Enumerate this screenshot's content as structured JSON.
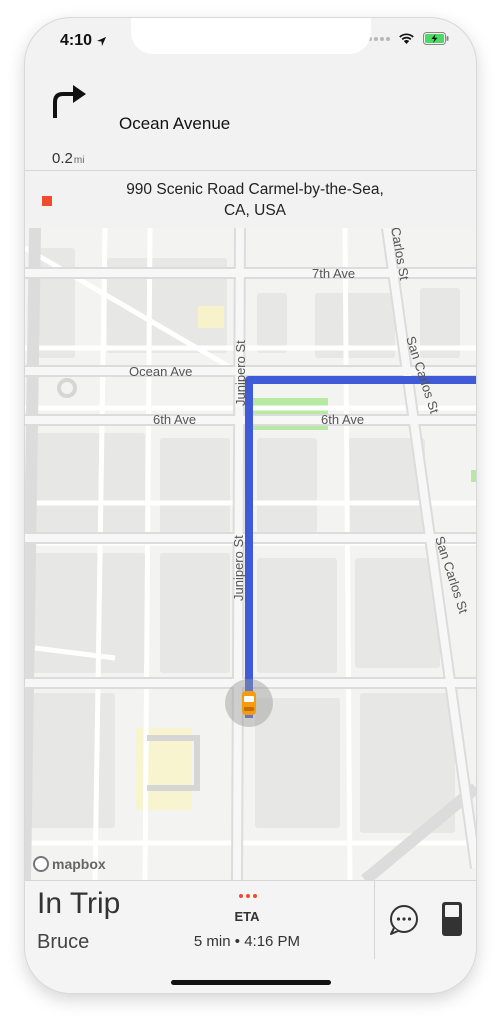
{
  "status_bar": {
    "time": "4:10"
  },
  "navigation": {
    "street": "Ocean Avenue",
    "distance": "0.2",
    "distance_unit": "mi"
  },
  "destination": {
    "line1": "990 Scenic Road Carmel-by-the-Sea,",
    "line2": "CA, USA"
  },
  "map": {
    "labels": {
      "seventh_ave": "7th Ave",
      "ocean_ave": "Ocean Ave",
      "sixth_ave_left": "6th Ave",
      "sixth_ave_right": "6th Ave",
      "junipero_top": "Junipero St",
      "junipero_mid": "Junipero St",
      "san_carlos_top": "San Carlos St",
      "san_carlos_mid": "San Carlos St",
      "san_carlos_edge": "Carlos St"
    },
    "attribution": "mapbox",
    "route_color": "#3f5bd8",
    "vehicle_color": "#f39c12"
  },
  "trip": {
    "status": "In Trip",
    "passenger": "Bruce",
    "eta_label": "ETA",
    "eta_value": "5 min • 4:16 PM"
  },
  "colors": {
    "accent": "#ee4c2c"
  }
}
